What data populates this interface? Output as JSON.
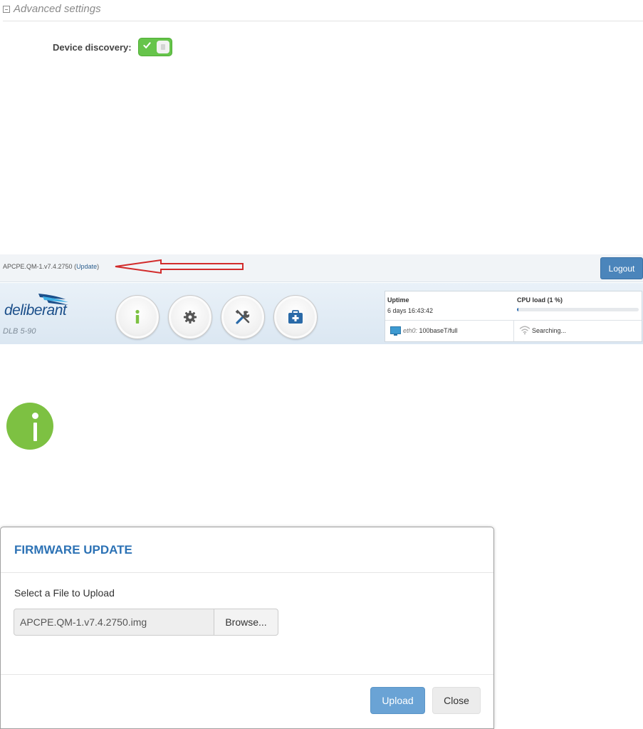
{
  "advanced_settings": {
    "header": "Advanced settings",
    "device_discovery_label": "Device discovery:",
    "device_discovery_enabled": true
  },
  "top_bar": {
    "firmware_version": "APCPE.QM-1.v7.4.2750",
    "update_open": "(",
    "update_link": "Update",
    "update_close": ")",
    "logout_label": "Logout"
  },
  "header": {
    "brand": "deliberant",
    "model": "DLB 5-90",
    "nav_icons": [
      "info-icon",
      "gear-icon",
      "tools-icon",
      "first-aid-icon"
    ],
    "accent_color": "#7dc142"
  },
  "status": {
    "uptime_label": "Uptime",
    "uptime_value": "6 days 16:43:42",
    "cpu_label": "CPU load (1 %)",
    "cpu_percent": 1,
    "eth_interface": "eth0:",
    "eth_speed": "100baseT/full",
    "wireless_status": "Searching..."
  },
  "modal": {
    "title": "FIRMWARE UPDATE",
    "file_label": "Select a File to Upload",
    "file_value": "APCPE.QM-1.v7.4.2750.img",
    "browse_label": "Browse...",
    "upload_label": "Upload",
    "close_label": "Close",
    "title_color": "#2c72b5"
  }
}
